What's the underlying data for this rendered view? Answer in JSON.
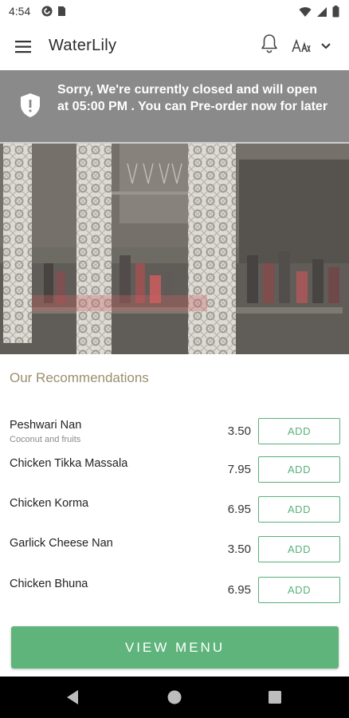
{
  "status_bar": {
    "time": "4:54",
    "icons": [
      "pocket-casts-icon",
      "sim-card-icon",
      "wifi-icon",
      "signal-icon",
      "battery-icon"
    ]
  },
  "app_bar": {
    "title": "WaterLily",
    "icons": [
      "hamburger-menu-icon",
      "bell-icon",
      "language-icon",
      "chevron-down-icon"
    ]
  },
  "closed_banner": {
    "text": "Sorry, We're currently closed and will open at 05:00 PM . You can Pre-order now for later",
    "icon": "shield-alert-icon"
  },
  "hero": {
    "description_icon": "restaurant-bar-photo"
  },
  "recommendations": {
    "title": "Our Recommendations",
    "items": [
      {
        "name": "Peshwari Nan",
        "description": "Coconut and fruits",
        "price": "3.50",
        "action": "ADD"
      },
      {
        "name": "Chicken Tikka Massala",
        "description": "",
        "price": "7.95",
        "action": "ADD"
      },
      {
        "name": "Chicken Korma",
        "description": "",
        "price": "6.95",
        "action": "ADD"
      },
      {
        "name": "Garlick Cheese Nan",
        "description": "",
        "price": "3.50",
        "action": "ADD"
      },
      {
        "name": "Chicken Bhuna",
        "description": "",
        "price": "6.95",
        "action": "ADD"
      }
    ]
  },
  "view_menu": {
    "label": "VIEW MENU"
  },
  "colors": {
    "accent_green": "#5fb47b",
    "banner_grey": "#8a8a8a",
    "section_title": "#9a8e6e"
  }
}
